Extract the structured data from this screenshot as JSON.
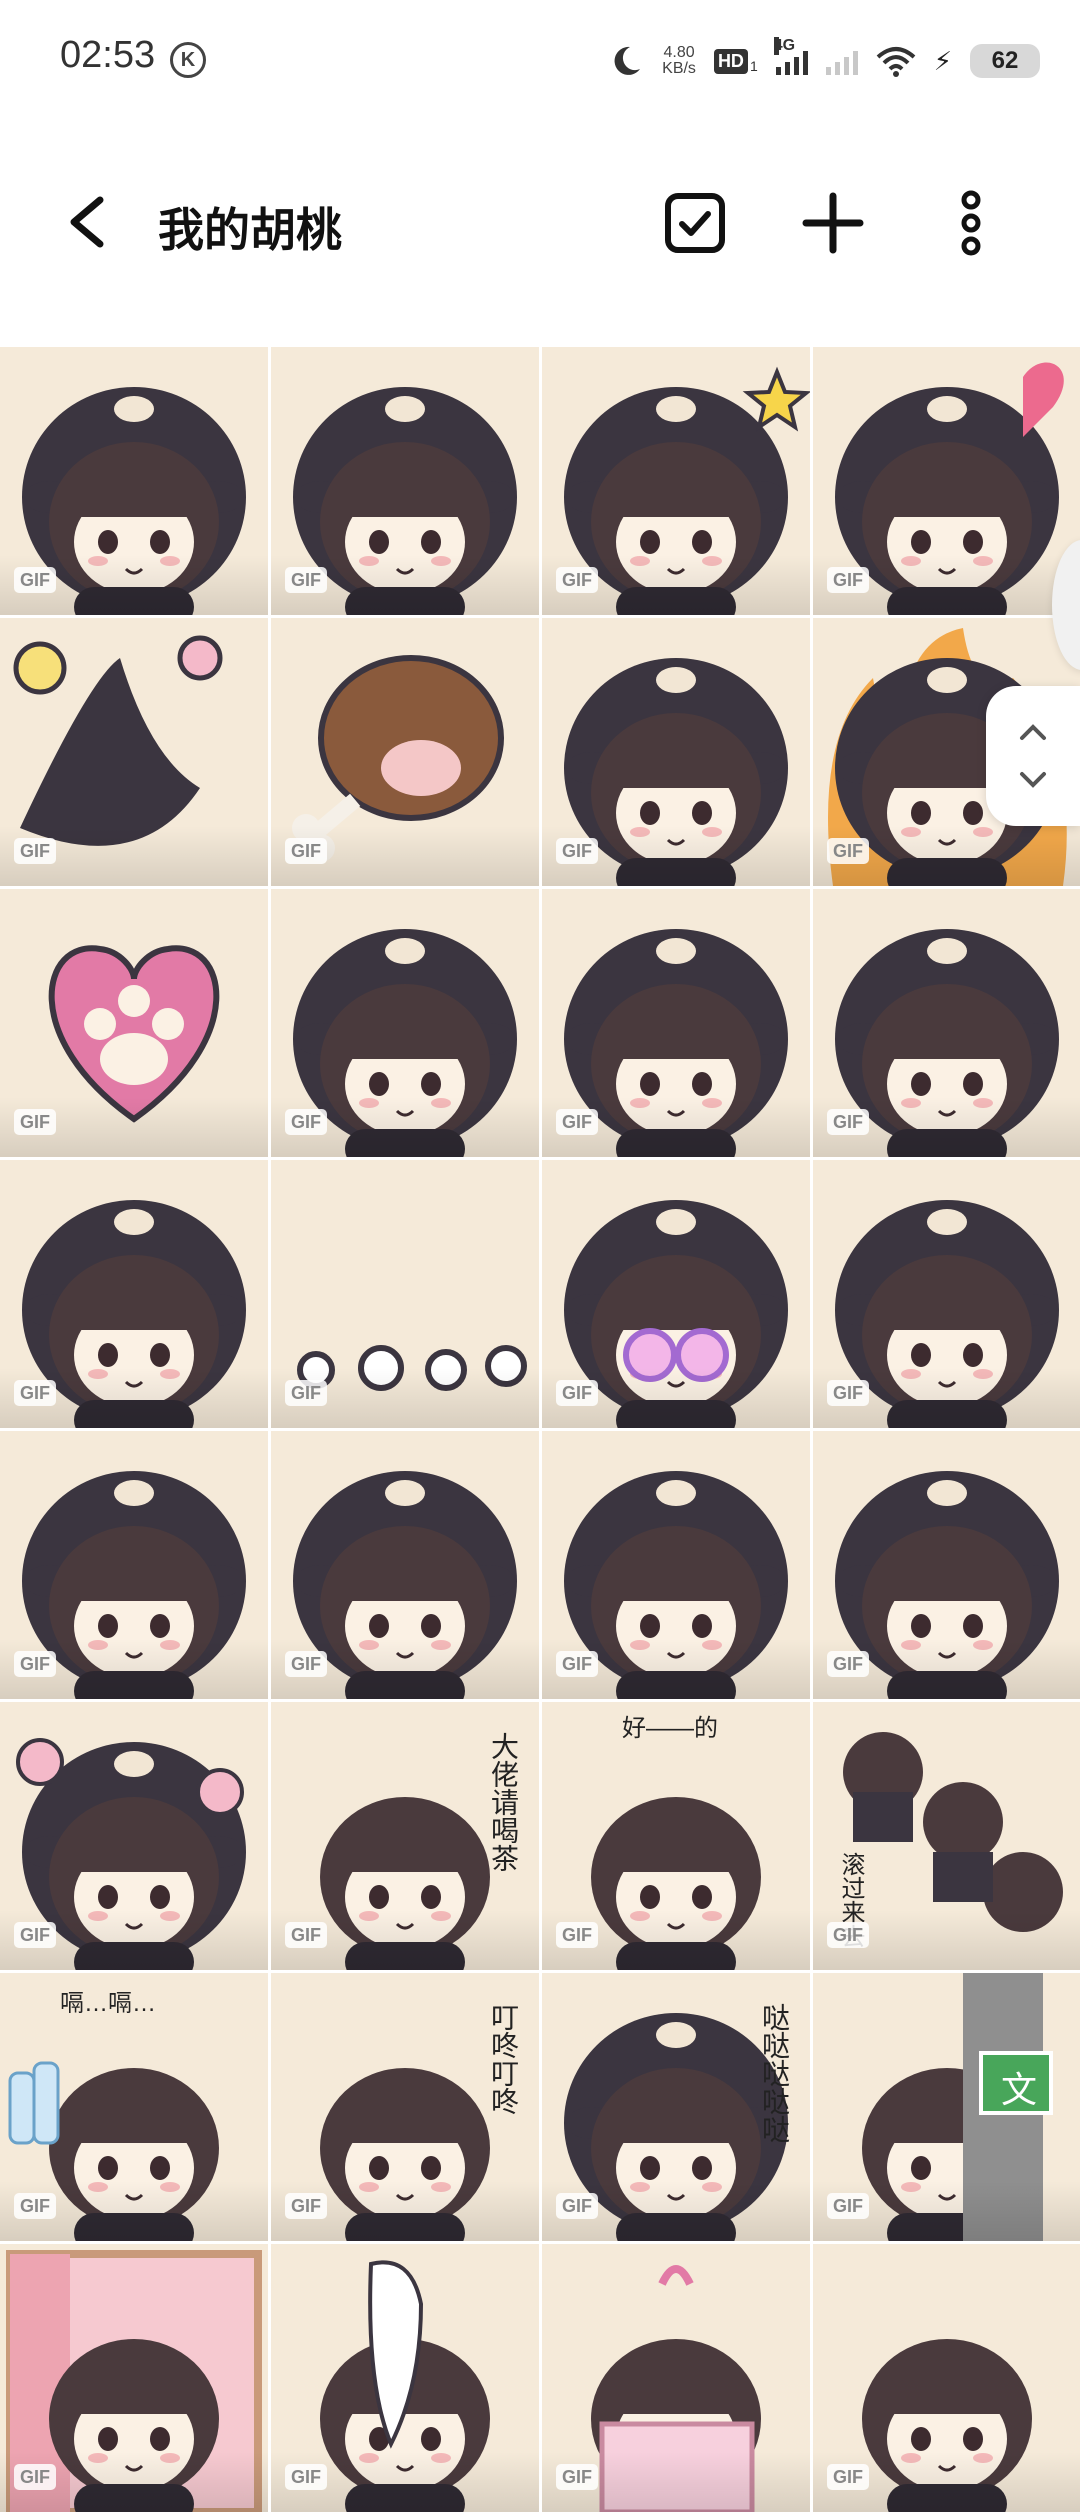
{
  "status_bar": {
    "time": "02:53",
    "k_badge": "K",
    "net_speed_value": "4.80",
    "net_speed_unit": "KB/s",
    "hd_label": "HD",
    "hd_sub": "1",
    "network": "4G",
    "battery": "62"
  },
  "app_bar": {
    "title": "我的胡桃",
    "icons": [
      "back-arrow-icon",
      "select-checkbox-icon",
      "add-icon",
      "more-vertical-icon"
    ]
  },
  "grid": {
    "badge": "GIF",
    "items": [
      {
        "desc": "girl-crying-open-mouth",
        "bg": "#f5ead9"
      },
      {
        "desc": "girl-happy-closed-eyes",
        "bg": "#f5ead9"
      },
      {
        "desc": "girl-wink-star",
        "bg": "#f5ead9"
      },
      {
        "desc": "girl-kiss-heart",
        "bg": "#f5ead9"
      },
      {
        "desc": "hoodie-flowers",
        "bg": "#f5ead9"
      },
      {
        "desc": "meat-drumstick",
        "bg": "#f5ead9"
      },
      {
        "desc": "girl-hood-thumbs-up",
        "bg": "#f5ead9"
      },
      {
        "desc": "girl-hood-fire",
        "bg": "#f5ead9"
      },
      {
        "desc": "pink-paw-heart",
        "bg": "#f5ead9"
      },
      {
        "desc": "hood-peek",
        "bg": "#f5ead9"
      },
      {
        "desc": "girl-jumping-happy",
        "bg": "#f5ead9"
      },
      {
        "desc": "girl-hood-sleepy",
        "bg": "#f5ead9"
      },
      {
        "desc": "girl-peek-side",
        "bg": "#f5ead9"
      },
      {
        "desc": "dust-clouds",
        "bg": "#f5ead9"
      },
      {
        "desc": "girl-pink-glasses",
        "bg": "#f5ead9"
      },
      {
        "desc": "girl-hood-neutral",
        "bg": "#f5ead9"
      },
      {
        "desc": "girl-hood-sad",
        "bg": "#f5ead9"
      },
      {
        "desc": "girl-hood-sparkle-eyes",
        "bg": "#f5ead9"
      },
      {
        "desc": "girl-hood-shocked",
        "bg": "#f5ead9"
      },
      {
        "desc": "girl-hood-grin",
        "bg": "#f5ead9"
      },
      {
        "desc": "girl-hood-flowers-smile",
        "bg": "#f5ead9"
      },
      {
        "desc": "girl-tea",
        "bg": "#f5ead9",
        "text": "大佬请喝茶"
      },
      {
        "desc": "girl-waving",
        "bg": "#f5ead9",
        "text": "好——的"
      },
      {
        "desc": "girls-rolling",
        "bg": "#f5ead9",
        "text": "滚过来去"
      },
      {
        "desc": "girl-drunk-bottles",
        "bg": "#f5ead9",
        "text": "嗝…嗝…"
      },
      {
        "desc": "girl-doorbell",
        "bg": "#f5ead9",
        "text": "叮咚叮咚"
      },
      {
        "desc": "girl-running-hood",
        "bg": "#f5ead9",
        "text": "哒哒哒哒哒"
      },
      {
        "desc": "girl-peek-sign",
        "bg": "#f5ead9",
        "text": "文"
      },
      {
        "desc": "girl-curtain",
        "bg": "#f5ead9"
      },
      {
        "desc": "girl-ghost",
        "bg": "#f5ead9"
      },
      {
        "desc": "girl-gift-box",
        "bg": "#f5ead9"
      },
      {
        "desc": "girl-wink-wave",
        "bg": "#f5ead9"
      }
    ]
  }
}
